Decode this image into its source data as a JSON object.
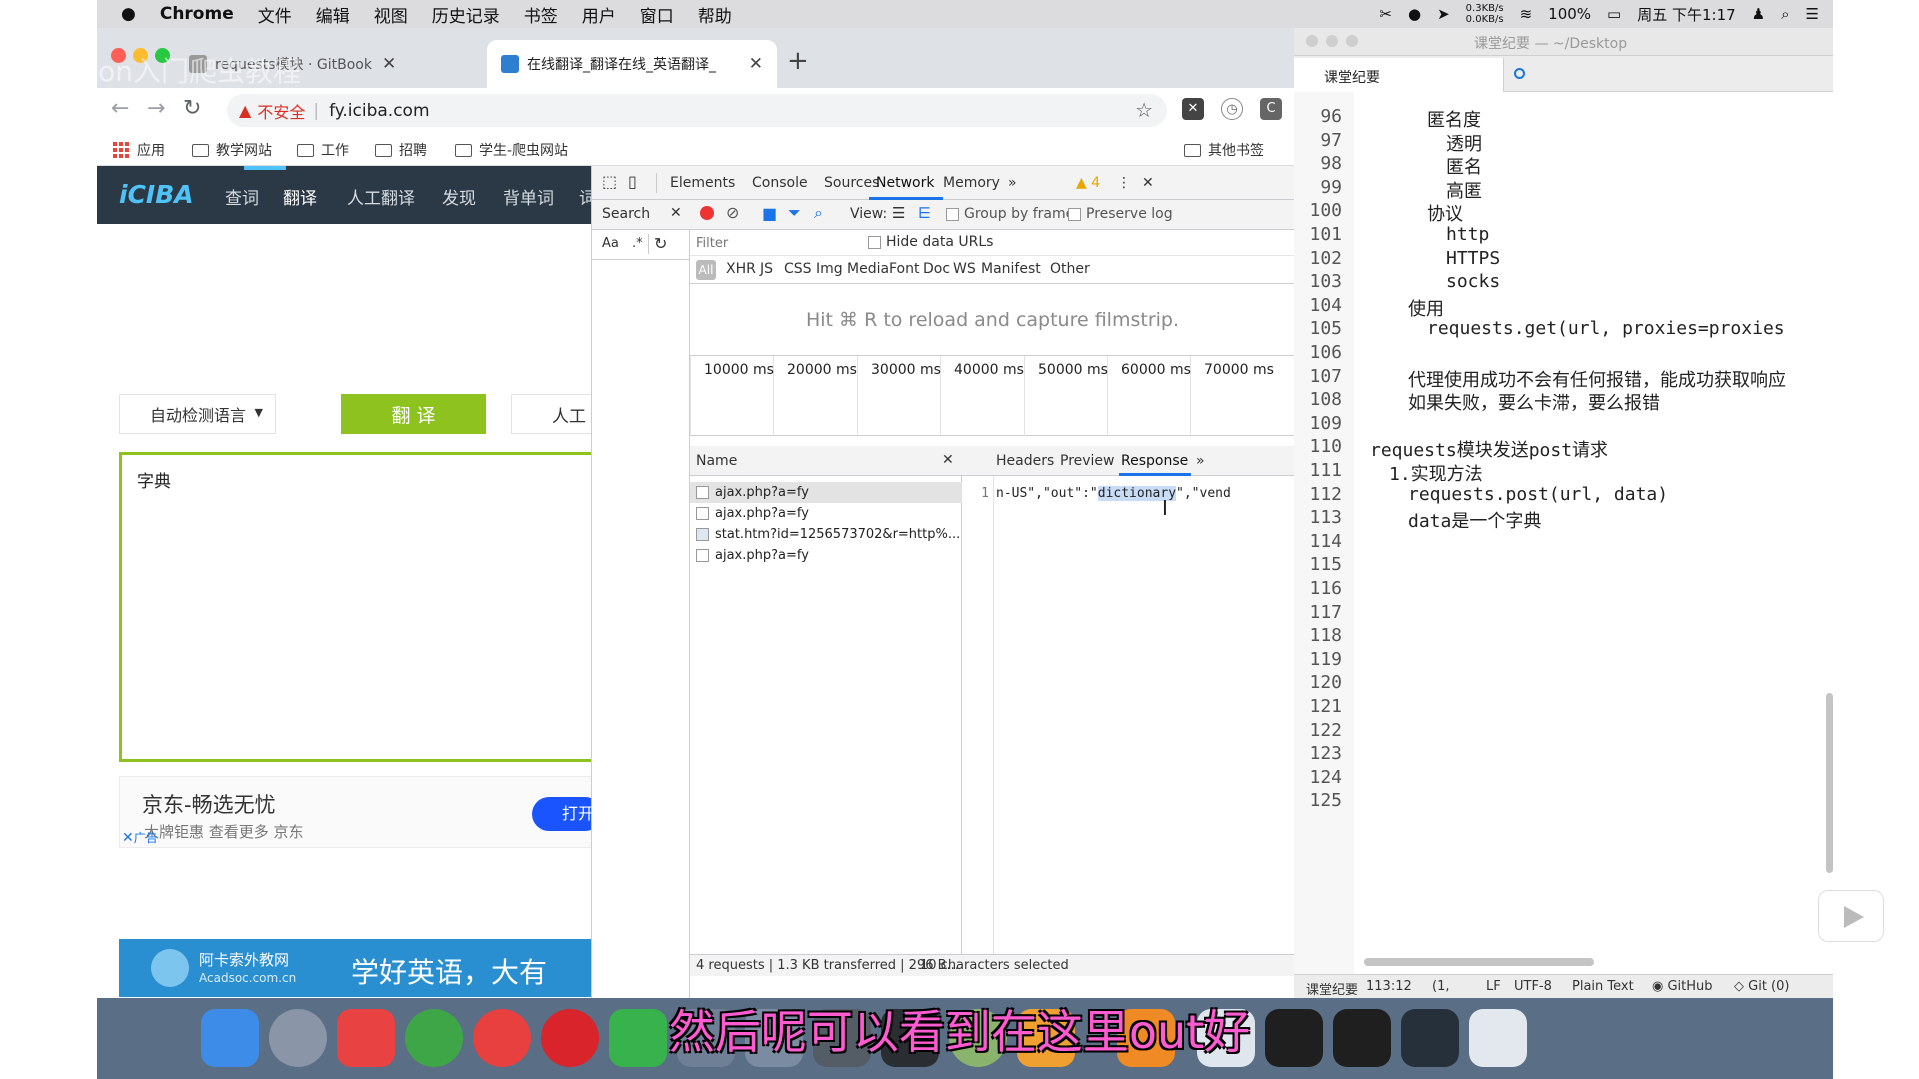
{
  "menubar": {
    "app": "Chrome",
    "items": [
      "文件",
      "编辑",
      "视图",
      "历史记录",
      "书签",
      "用户",
      "窗口",
      "帮助"
    ],
    "net_speed_up": "0.3KB/s",
    "net_speed_down": "0.0KB/s",
    "battery": "100%",
    "clock": "周五 下午1:17"
  },
  "watermark": "Python入门爬虫教程",
  "chrome": {
    "tabs": [
      {
        "title": "requests模块 · GitBook",
        "active": false
      },
      {
        "title": "在线翻译_翻译在线_英语翻译_",
        "active": true
      }
    ],
    "url_warning": "不安全",
    "url": "fy.iciba.com",
    "bookmarks": [
      "应用",
      "教学网站",
      "工作",
      "招聘",
      "学生-爬虫网站"
    ],
    "other_bookmarks": "其他书签"
  },
  "iciba": {
    "logo": "iCIBA",
    "nav": [
      "查词",
      "翻译",
      "人工翻译",
      "发现",
      "背单词",
      "词"
    ],
    "lang_select": "自动检测语言",
    "translate_btn": "翻 译",
    "human_btn": "人工",
    "input_text": "字典",
    "ad1_title": "京东-畅选无忧",
    "ad1_sub": "大牌钜惠 查看更多 京东",
    "ad1_tag": "广告",
    "ad1_btn": "打开",
    "ad2_brand": "阿卡索外教网",
    "ad2_brand_en": "Acadsoc.com.cn",
    "ad2_slogan": "学好英语，大有"
  },
  "devtools": {
    "tabs": [
      "Elements",
      "Console",
      "Sources",
      "Network",
      "Memory"
    ],
    "active_tab": "Network",
    "warnings": "4",
    "search_label": "Search",
    "aa": "Aa",
    "regex": ".*",
    "view_label": "View:",
    "group_by_frame": "Group by frame",
    "preserve_log": "Preserve log",
    "filter_placeholder": "Filter",
    "hide_data_urls": "Hide data URLs",
    "types": [
      "All",
      "XHR",
      "JS",
      "CSS",
      "Img",
      "Media",
      "Font",
      "Doc",
      "WS",
      "Manifest",
      "Other"
    ],
    "filmstrip_hint": "Hit ⌘ R to reload and capture filmstrip.",
    "timeline_ticks": [
      "10000 ms",
      "20000 ms",
      "30000 ms",
      "40000 ms",
      "50000 ms",
      "60000 ms",
      "70000 ms"
    ],
    "name_header": "Name",
    "requests": [
      {
        "name": "ajax.php?a=fy",
        "selected": true
      },
      {
        "name": "ajax.php?a=fy",
        "selected": false
      },
      {
        "name": "stat.htm?id=1256573702&r=http%...",
        "selected": false
      },
      {
        "name": "ajax.php?a=fy",
        "selected": false
      }
    ],
    "detail_tabs": [
      "Headers",
      "Preview",
      "Response"
    ],
    "active_detail_tab": "Response",
    "response_line_no": "1",
    "response_before": "n-US\",\"out\":\"",
    "response_highlight": "dictionary",
    "response_after": "\",\"vend",
    "status_left": "4 requests | 1.3 KB transferred | 296 B...",
    "status_right": "10 characters selected"
  },
  "editor": {
    "title": "课堂纪要 — ~/Desktop",
    "tab": "课堂纪要",
    "line_numbers": [
      "96",
      "97",
      "98",
      "99",
      "100",
      "101",
      "102",
      "103",
      "104",
      "105",
      "106",
      "107",
      "108",
      "109",
      "110",
      "111",
      "112",
      "113",
      "114",
      "115",
      "116",
      "117",
      "118",
      "119",
      "120",
      "121",
      "122",
      "123",
      "124",
      "125"
    ],
    "lines": [
      {
        "indent": 3,
        "text": "匿名度"
      },
      {
        "indent": 4,
        "text": "透明"
      },
      {
        "indent": 4,
        "text": "匿名"
      },
      {
        "indent": 4,
        "text": "高匿"
      },
      {
        "indent": 3,
        "text": "协议"
      },
      {
        "indent": 4,
        "text": "http"
      },
      {
        "indent": 4,
        "text": "HTTPS"
      },
      {
        "indent": 4,
        "text": "socks"
      },
      {
        "indent": 2,
        "text": "使用"
      },
      {
        "indent": 3,
        "text": "requests.get(url, proxies=proxies"
      },
      {
        "indent": 0,
        "text": ""
      },
      {
        "indent": 2,
        "text": "代理使用成功不会有任何报错，能成功获取响应"
      },
      {
        "indent": 2,
        "text": "如果失败，要么卡滞，要么报错"
      },
      {
        "indent": 0,
        "text": ""
      },
      {
        "indent": 0,
        "text": "requests模块发送post请求"
      },
      {
        "indent": 1,
        "text": "1.实现方法"
      },
      {
        "indent": 2,
        "text": "requests.post(url, data)"
      },
      {
        "indent": 2,
        "text": "data是一个字典"
      }
    ],
    "status": {
      "file": "课堂纪要",
      "position": "113:12",
      "paren": "(1,",
      "line_ending": "LF",
      "encoding": "UTF-8",
      "syntax": "Plain Text",
      "github": "GitHub",
      "git": "Git (0)"
    }
  },
  "subtitle": "然后呢可以看到在这里out好",
  "colors": {
    "accent_green": "#8dc21f",
    "nav_dark": "#2b3845",
    "devtools_blue": "#1a73e8",
    "subtitle_pink": "#ff5bd0"
  }
}
